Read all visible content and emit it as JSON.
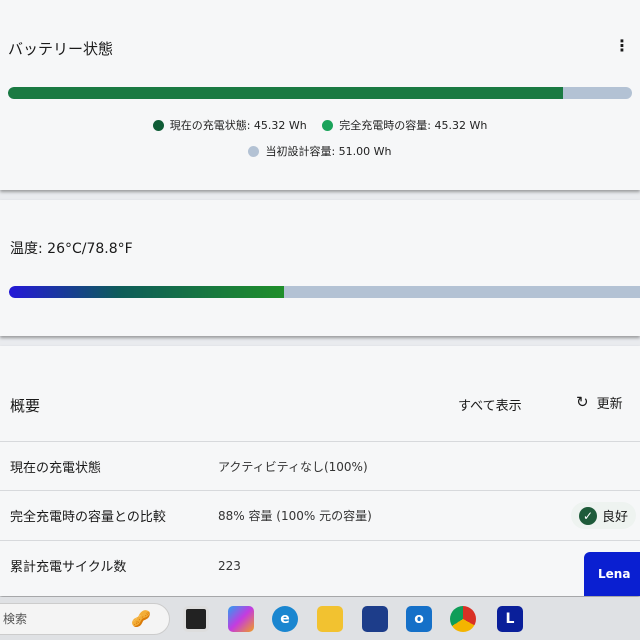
{
  "battery": {
    "title": "バッテリー状態",
    "menu_icon": "more-vertical-icon",
    "charge_fraction": 0.889,
    "legend": [
      {
        "label": "現在の充電状態: 45.32 Wh",
        "color": "#0f5c36"
      },
      {
        "label": "完全充電時の容量: 45.32 Wh",
        "color": "#1aa35a"
      },
      {
        "label": "当初設計容量: 51.00 Wh",
        "color": "#b3c2d4"
      }
    ]
  },
  "temperature": {
    "label": "温度: 26°C/78.8°F",
    "fraction": 0.43
  },
  "overview": {
    "title": "概要",
    "show_all": "すべて表示",
    "refresh": "更新",
    "rows": [
      {
        "key": "現在の充電状態",
        "value": "アクティビティなし(100%)"
      },
      {
        "key": "完全充電時の容量との比較",
        "value": "88% 容量 (100% 元の容量)",
        "badge": "良好"
      },
      {
        "key": "累計充電サイクル数",
        "value": "223"
      }
    ]
  },
  "lena_button": "Lena",
  "taskbar": {
    "search_placeholder": "検索",
    "apps": [
      "task-view",
      "copilot",
      "edge",
      "file-explorer",
      "store",
      "outlook",
      "chrome",
      "lenovo-vantage"
    ]
  }
}
